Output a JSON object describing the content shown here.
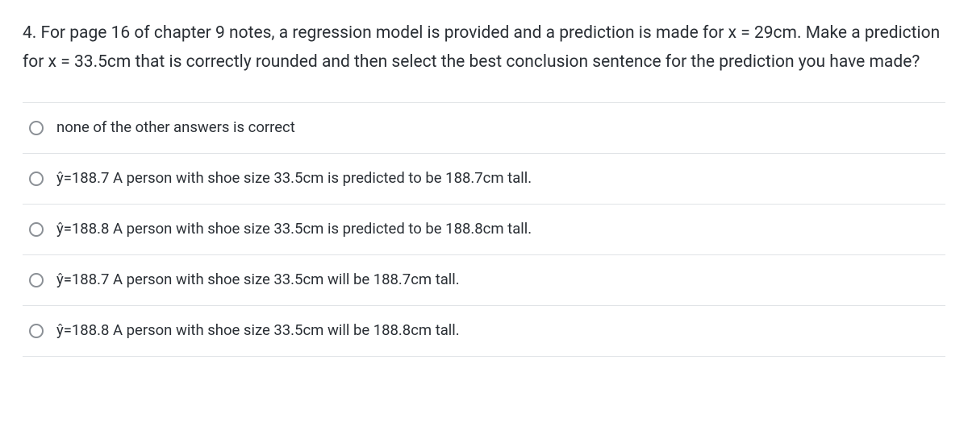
{
  "question": {
    "text": "4. For page 16 of chapter 9 notes, a regression model is provided and a prediction is made for x = 29cm. Make a prediction for x = 33.5cm that is correctly rounded and then select the best conclusion sentence for the prediction you have made?"
  },
  "options": [
    {
      "label": "none of the other answers is correct"
    },
    {
      "label": "ŷ=188.7 A person with shoe size 33.5cm is predicted to be 188.7cm tall."
    },
    {
      "label": "ŷ=188.8 A person with shoe size 33.5cm is predicted to be 188.8cm tall."
    },
    {
      "label": "ŷ=188.7 A person with shoe size 33.5cm will be 188.7cm tall."
    },
    {
      "label": "ŷ=188.8 A person with shoe size 33.5cm will be 188.8cm tall."
    }
  ]
}
